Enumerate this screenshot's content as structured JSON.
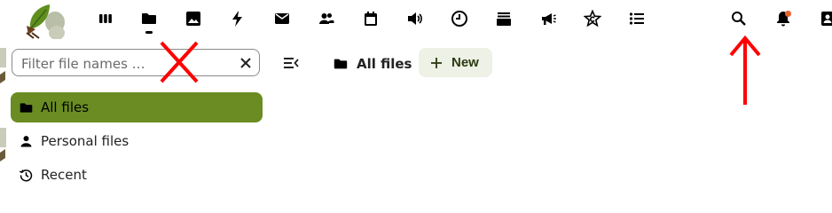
{
  "header": {
    "apps": [
      {
        "name": "dashboard",
        "icon": "dashboard-icon"
      },
      {
        "name": "files",
        "icon": "folder-icon",
        "active": true
      },
      {
        "name": "photos",
        "icon": "image-icon"
      },
      {
        "name": "activity",
        "icon": "lightning-icon"
      },
      {
        "name": "mail",
        "icon": "mail-icon"
      },
      {
        "name": "contacts",
        "icon": "contacts-icon"
      },
      {
        "name": "calendar",
        "icon": "calendar-icon"
      },
      {
        "name": "talk",
        "icon": "speaker-icon"
      },
      {
        "name": "clock",
        "icon": "clock-icon"
      },
      {
        "name": "deck",
        "icon": "stack-icon"
      },
      {
        "name": "announcements",
        "icon": "megaphone-icon"
      },
      {
        "name": "recognize",
        "icon": "star-c-icon"
      },
      {
        "name": "tasks",
        "icon": "list-icon"
      }
    ],
    "right": [
      "search-icon",
      "notifications-icon",
      "contacts-menu-icon"
    ],
    "notification_badge_color": "#e9622c"
  },
  "sidebar": {
    "search_placeholder": "Filter file names …",
    "items": [
      {
        "label": "All files",
        "icon": "folder-icon",
        "active": true
      },
      {
        "label": "Personal files",
        "icon": "person-icon"
      },
      {
        "label": "Recent",
        "icon": "history-icon"
      }
    ],
    "active_color": "#6a8c22"
  },
  "toolbar": {
    "breadcrumb": "All files",
    "new_label": "New"
  },
  "annotations": {
    "color": "#ff0000",
    "items": [
      "red-x-mark",
      "red-up-arrow"
    ]
  }
}
